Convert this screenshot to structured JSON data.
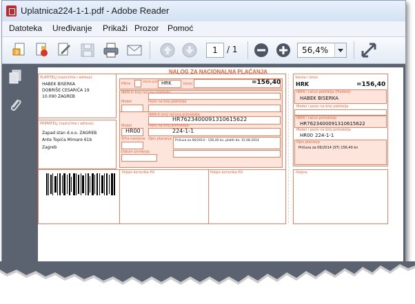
{
  "window": {
    "title": "Uplatnica224-1-1.pdf - Adobe Reader"
  },
  "menu": {
    "items": [
      "Datoteka",
      "Uređivanje",
      "Prikaži",
      "Prozor",
      "Pomoć"
    ]
  },
  "toolbar": {
    "current_page": "1",
    "page_total": "/ 1",
    "zoom": "56,4%",
    "icons": [
      "create-pdf-icon",
      "collaborate-icon",
      "sign-icon",
      "save-icon",
      "print-icon",
      "email-icon",
      "previous-page-icon",
      "next-page-icon",
      "zoom-out-icon",
      "zoom-in-icon",
      "zoom-dropdown-icon",
      "fullscreen-icon"
    ]
  },
  "sidebar": {
    "icons": [
      "pages-icon",
      "attachments-icon"
    ]
  },
  "form": {
    "heading": "NALOG ZA NACIONALNA PLAĆANJA",
    "payer_label": "PLATITELJ (naziv/ime i adresa):",
    "payer_name": "HABEK BISERKA",
    "payer_street": "DOBRIŠE CESARIĆA 19",
    "payer_city": "10.090 ZAGREB",
    "hitno_label": "Hitno",
    "valuta_label": "Valuta plaćanja",
    "currency": "HRK",
    "iznos_label": "Iznos",
    "amount": "=156,40",
    "iban_payer_label": "IBAN ili broj računa platitelja",
    "model_label": "Model",
    "poziv_payer_label": "Poziv na broj platitelja",
    "recipient_label": "PRIMATELJ (naziv/ime i adresa):",
    "recipient_name": "Zapad stan d.o.o. ZAGREB",
    "recipient_street": "Ante Topića Mimare 61b",
    "recipient_city": "Zagreb",
    "iban_recipient_label": "IBAN ili broj računa primatelja",
    "iban_recipient": "HR7623400091310615622",
    "model_value": "HR00",
    "poziv_recipient_label": "Poziv na broj primatelja",
    "poziv_recipient": "224-1-1",
    "sifra_label": "Šifra namjene",
    "opis_label": "Opis plaćanja",
    "opis": "Pričuva za 06/2014 - 156,40 kn, platiti do: 15.08.2014",
    "datum_label": "Datum izvršenja",
    "potpis_korisnika": "Potpis korisnika PU",
    "potpis_korisnika2": "Potpis korisnika PU",
    "slip_valuta_label": "Valuta i iznos",
    "slip_currency": "HRK",
    "slip_amount": "=156,40",
    "slip_iban_payer_label": "IBAN / račun platitelja (Platitelj)",
    "slip_payer": "HABEK BISERKA",
    "slip_model_poziv_payer_label": "Model i poziv na broj platitelja",
    "slip_iban_recipient_label": "IBAN / račun primatelja",
    "slip_iban_recipient": "HR7623400091310615622",
    "slip_model_poziv_recipient_label": "Model i poziv na broj primatelja",
    "slip_model": "HR00",
    "slip_poziv": "224-1-1",
    "slip_opis_label": "Opis plaćanja",
    "slip_opis": "Pričuva za 06/2014 (ST) 156,40 kn",
    "slip_ovjera_label": "Ovjera"
  },
  "colors": {
    "form_accent": "#e8603c",
    "viewer_bg": "#5c6370"
  }
}
